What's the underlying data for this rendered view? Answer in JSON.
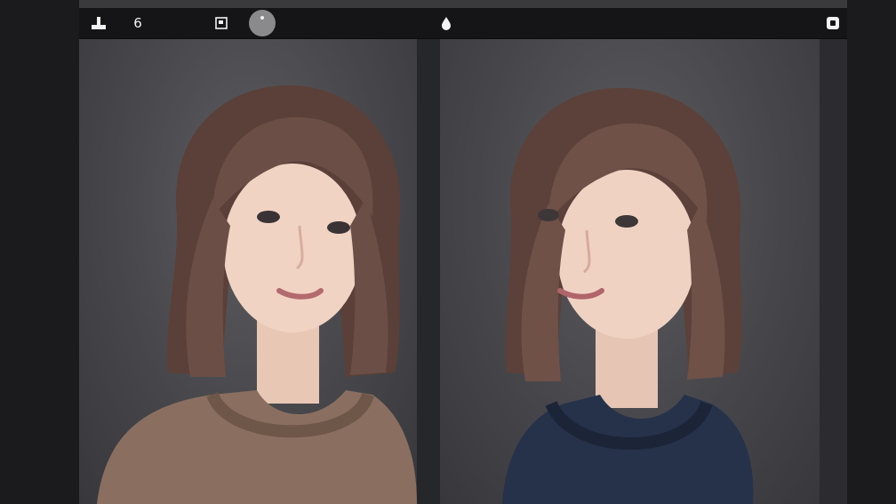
{
  "toolbar": {
    "tools": [
      {
        "name": "stamp-tool",
        "glyph": "▲"
      },
      {
        "name": "undo-tool",
        "glyph": "6"
      },
      {
        "name": "frame-tool",
        "glyph": "▣"
      },
      {
        "name": "brush-size-tool",
        "glyph": ""
      },
      {
        "name": "drop-tool",
        "glyph": "●"
      },
      {
        "name": "export-tool",
        "glyph": "▣"
      }
    ]
  },
  "panels": [
    {
      "name": "left-portrait",
      "sweater_color": "#8a6f60",
      "hair_color": "#6b4e45"
    },
    {
      "name": "right-portrait",
      "sweater_color": "#26324a",
      "hair_color": "#6f5148"
    }
  ],
  "colors": {
    "background": "#1c1c1e",
    "toolbar": "#151517",
    "panel": "#4a4a4e"
  }
}
